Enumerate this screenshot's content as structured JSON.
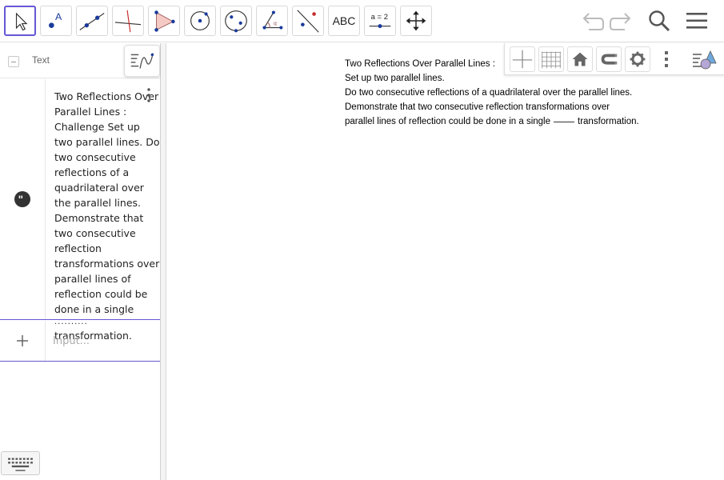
{
  "toolbar": {
    "tools": [
      {
        "name": "move",
        "label": ""
      },
      {
        "name": "point",
        "label": ""
      },
      {
        "name": "line",
        "label": ""
      },
      {
        "name": "perpendicular-line",
        "label": ""
      },
      {
        "name": "polygon",
        "label": ""
      },
      {
        "name": "circle-center-point",
        "label": ""
      },
      {
        "name": "ellipse",
        "label": ""
      },
      {
        "name": "angle",
        "label": ""
      },
      {
        "name": "reflect-about-line",
        "label": ""
      },
      {
        "name": "text",
        "label": "ABC"
      },
      {
        "name": "slider",
        "label": "a = 2"
      },
      {
        "name": "move-graphics-view",
        "label": ""
      }
    ],
    "accent_color": "#6557d2"
  },
  "algebra": {
    "header_title": "Text",
    "item_text": "Two Reflections Over Parallel Lines : Challenge Set up two parallel lines. Do two consecutive reflections of a quadrilateral over the parallel lines. Demonstrate that two consecutive reflection transformations over parallel lines of reflection could be done in a single",
    "item_blank": "..........",
    "item_text_end": "transformation.",
    "input_placeholder": "Input..."
  },
  "graphics": {
    "lines": [
      "Two Reflections Over Parallel Lines :",
      "Set up two parallel lines.",
      "Do two consecutive reflections of  a quadrilateral over the parallel lines.",
      "Demonstrate that two consecutive reflection transformations over"
    ],
    "last_line_start": "parallel lines of reflection could be done in a single",
    "last_line_end": "transformation."
  }
}
